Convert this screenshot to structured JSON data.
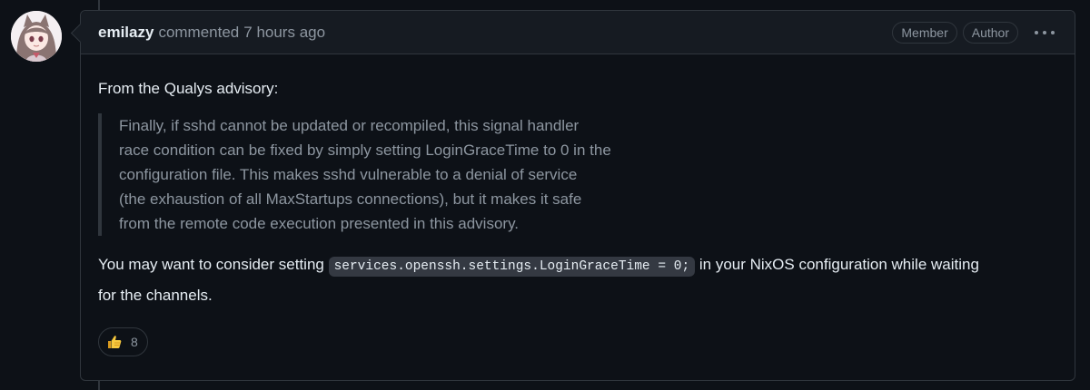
{
  "comment": {
    "author": "emilazy",
    "action": "commented",
    "time": "7 hours ago",
    "badges": [
      "Member",
      "Author"
    ],
    "menu_icon": "kebab-horizontal-icon",
    "avatar_icon": "anime-avatar"
  },
  "body": {
    "intro": "From the Qualys advisory:",
    "quote_lines": [
      "Finally, if sshd cannot be updated or recompiled, this signal handler",
      "race condition can be fixed by simply setting LoginGraceTime to 0 in the",
      "configuration file. This makes sshd vulnerable to a denial of service",
      "(the exhaustion of all MaxStartups connections), but it makes it safe",
      "from the remote code execution presented in this advisory."
    ],
    "para_before_code": "You may want to consider setting ",
    "code": "services.openssh.settings.LoginGraceTime = 0;",
    "para_after_code": " in your NixOS configuration while waiting",
    "para_line2": "for the channels."
  },
  "reactions": [
    {
      "emoji": "thumbs-up-icon",
      "count": "8"
    }
  ],
  "colors": {
    "background": "#0d1117",
    "header_bg": "#161b22",
    "border": "#30363d",
    "muted_text": "#8d96a0"
  }
}
